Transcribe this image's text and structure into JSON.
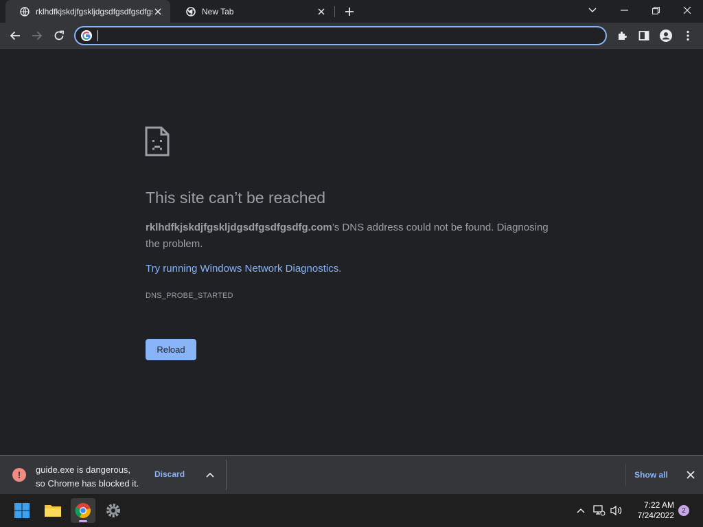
{
  "tabs": [
    {
      "title": "rklhdfkjskdjfgskljdgsdfgsdfgsdfgsdfg.com",
      "active": true
    },
    {
      "title": "New Tab",
      "active": false
    }
  ],
  "omnibox": {
    "value": "",
    "placeholder": ""
  },
  "error": {
    "title": "This site can’t be reached",
    "host": "rklhdfkjskdjfgskljdgsdfgsdfgsdfg.com",
    "desc_suffix": "’s DNS address could not be found. Diagnosing the problem.",
    "diagnostics_link": "Try running Windows Network Diagnostics.",
    "code": "DNS_PROBE_STARTED",
    "reload_label": "Reload"
  },
  "download_bar": {
    "message_line1": "guide.exe is dangerous,",
    "message_line2": "so Chrome has blocked it.",
    "discard_label": "Discard",
    "show_all_label": "Show all"
  },
  "taskbar": {
    "time": "7:22 AM",
    "date": "7/24/2022",
    "notification_count": "2"
  },
  "colors": {
    "accent": "#8ab4f8",
    "page_bg": "#202124",
    "toolbar_bg": "#35363a",
    "danger": "#f28b82"
  }
}
